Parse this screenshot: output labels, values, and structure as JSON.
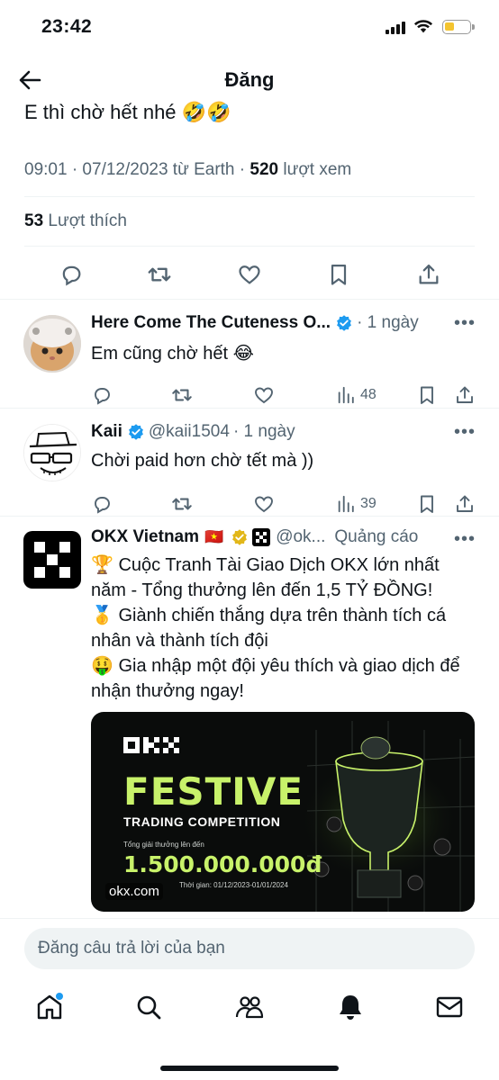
{
  "status": {
    "time": "23:42"
  },
  "header": {
    "title": "Đăng"
  },
  "post": {
    "text_tail": "E thì chờ hết nhé 🤣🤣",
    "meta_prefix": "09:01 · 07/12/2023 từ Earth · ",
    "views_count": "520",
    "views_label": " lượt xem",
    "likes_count": "53",
    "likes_label": " Lượt thích"
  },
  "replies": [
    {
      "name": "Here Come The Cuteness O...",
      "handle": "",
      "time": "· 1 ngày",
      "text": "Em cũng chờ hết 😂",
      "views": "48"
    },
    {
      "name": "Kaii",
      "handle": "@kaii1504",
      "time": "· 1 ngày",
      "text": "Chời paid hơn chờ tết mà ))",
      "views": "39"
    }
  ],
  "ad": {
    "name": "OKX Vietnam",
    "flag": "🇻🇳",
    "handle": "@ok...",
    "label": "Quảng cáo",
    "lines": [
      "🏆 Cuộc Tranh Tài Giao Dịch OKX lớn nhất năm - Tổng thưởng lên đến 1,5 TỶ ĐỒNG!",
      "🥇 Giành chiến thắng dựa trên thành tích cá nhân và thành tích đội",
      "🤑 Gia nhập một đội yêu thích và giao dịch để nhận thưởng ngay!"
    ],
    "card": {
      "festive": "FESTIVE",
      "subtitle": "TRADING COMPETITION",
      "prize_label": "Tổng giải thưởng lên đến",
      "prize": "1.500.000.000đ",
      "time_label": "Thời gian: 01/12/2023-01/01/2024",
      "domain": "okx.com"
    }
  },
  "reply_input": {
    "placeholder": "Đăng câu trả lời của bạn"
  },
  "colors": {
    "accent": "#1d9bf0",
    "secondary_text": "#536471",
    "okx_green": "#c8f26a"
  }
}
